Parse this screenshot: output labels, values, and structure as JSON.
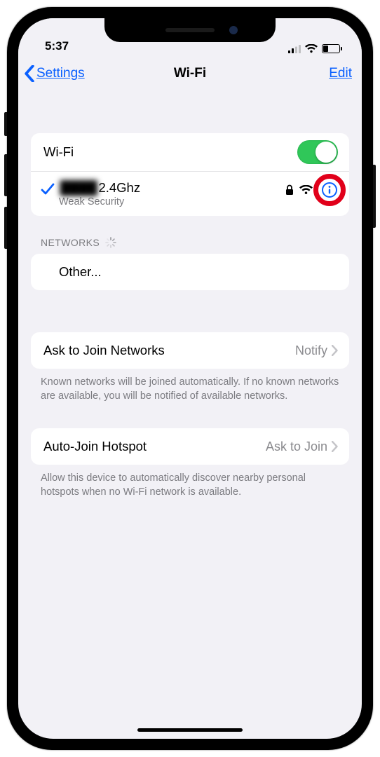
{
  "status_bar": {
    "time": "5:37"
  },
  "nav": {
    "back_label": "Settings",
    "title": "Wi-Fi",
    "edit_label": "Edit"
  },
  "wifi_toggle": {
    "label": "Wi-Fi",
    "on": true
  },
  "connected_network": {
    "name_blurred": "████",
    "name_suffix": " 2.4Ghz",
    "subtitle": "Weak Security"
  },
  "networks_header": "NETWORKS",
  "other_label": "Other...",
  "ask_to_join": {
    "label": "Ask to Join Networks",
    "value": "Notify",
    "footer": "Known networks will be joined automatically. If no known networks are available, you will be notified of available networks."
  },
  "auto_join_hotspot": {
    "label": "Auto-Join Hotspot",
    "value": "Ask to Join",
    "footer": "Allow this device to automatically discover nearby personal hotspots when no Wi-Fi network is available."
  }
}
